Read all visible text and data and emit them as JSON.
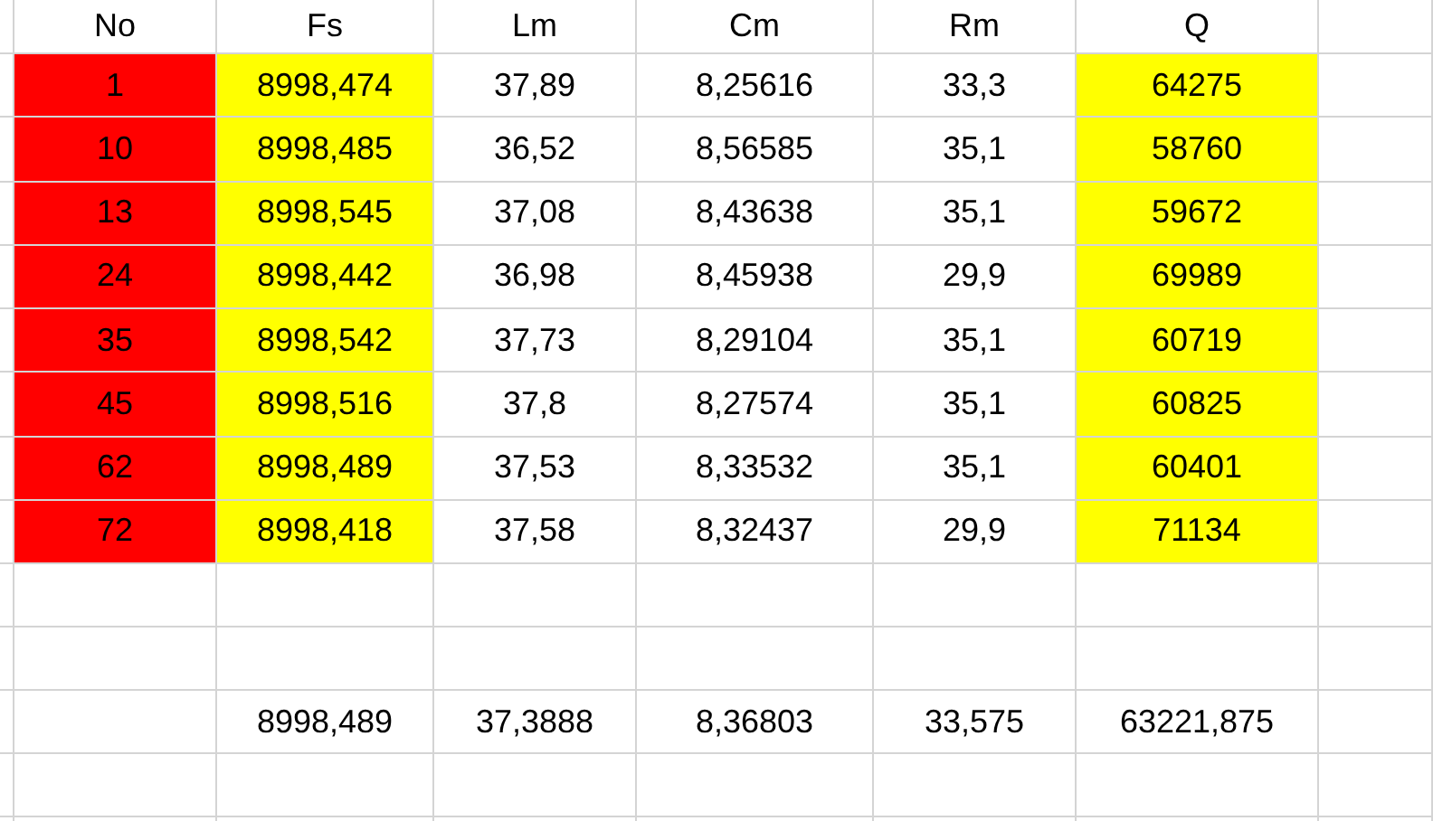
{
  "columns": [
    {
      "label": "No",
      "color": "#ff0000"
    },
    {
      "label": "Fs",
      "color": "#ffff00"
    },
    {
      "label": "Lm"
    },
    {
      "label": "Cm"
    },
    {
      "label": "Rm"
    },
    {
      "label": "Q",
      "color": "#ffff00"
    }
  ],
  "rows": [
    [
      "1",
      "8998,474",
      "37,89",
      "8,25616",
      "33,3",
      "64275"
    ],
    [
      "10",
      "8998,485",
      "36,52",
      "8,56585",
      "35,1",
      "58760"
    ],
    [
      "13",
      "8998,545",
      "37,08",
      "8,43638",
      "35,1",
      "59672"
    ],
    [
      "24",
      "8998,442",
      "36,98",
      "8,45938",
      "29,9",
      "69989"
    ],
    [
      "35",
      "8998,542",
      "37,73",
      "8,29104",
      "35,1",
      "60719"
    ],
    [
      "45",
      "8998,516",
      "37,8",
      "8,27574",
      "35,1",
      "60825"
    ],
    [
      "62",
      "8998,489",
      "37,53",
      "8,33532",
      "35,1",
      "60401"
    ],
    [
      "72",
      "8998,418",
      "37,58",
      "8,32437",
      "29,9",
      "71134"
    ]
  ],
  "averages": [
    "8998,489",
    "37,3888",
    "8,36803",
    "33,575",
    "63221,875"
  ]
}
